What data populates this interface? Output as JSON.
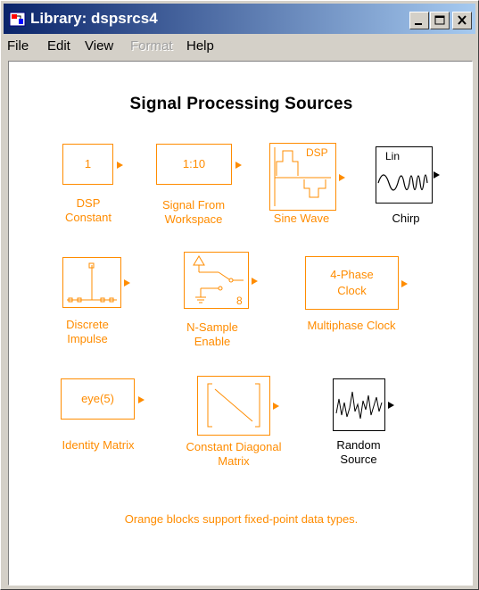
{
  "window": {
    "title": "Library: dspsrcs4"
  },
  "menu": [
    "File",
    "Edit",
    "View",
    "Format",
    "Help"
  ],
  "library_title": "Signal Processing Sources",
  "blocks": {
    "dsp_constant": {
      "text": "1",
      "label_line1": "DSP",
      "label_line2": "Constant"
    },
    "signal_from_workspace": {
      "text": "1:10",
      "label_line1": "Signal From",
      "label_line2": "Workspace"
    },
    "sine_wave": {
      "icon_text": "DSP",
      "label_line1": "Sine Wave"
    },
    "chirp": {
      "icon_text": "Lin",
      "label_line1": "Chirp"
    },
    "discrete_impulse": {
      "label_line1": "Discrete",
      "label_line2": "Impulse"
    },
    "n_sample_enable": {
      "icon_text": "8",
      "label_line1": "N-Sample",
      "label_line2": "Enable"
    },
    "multiphase_clock": {
      "text_line1": "4-Phase",
      "text_line2": "Clock",
      "label_line1": "Multiphase Clock"
    },
    "identity_matrix": {
      "text": "eye(5)",
      "label_line1": "Identity Matrix"
    },
    "constant_diagonal_matrix": {
      "label_line1": "Constant Diagonal",
      "label_line2": "Matrix"
    },
    "random_source": {
      "label_line1": "Random",
      "label_line2": "Source"
    }
  },
  "footer_note": "Orange blocks support fixed-point data types.",
  "colors": {
    "accent_block": "#ff8c00",
    "title_bar_start": "#0a246a",
    "title_bar_end": "#a6caf0",
    "chrome": "#d4d0c8"
  }
}
